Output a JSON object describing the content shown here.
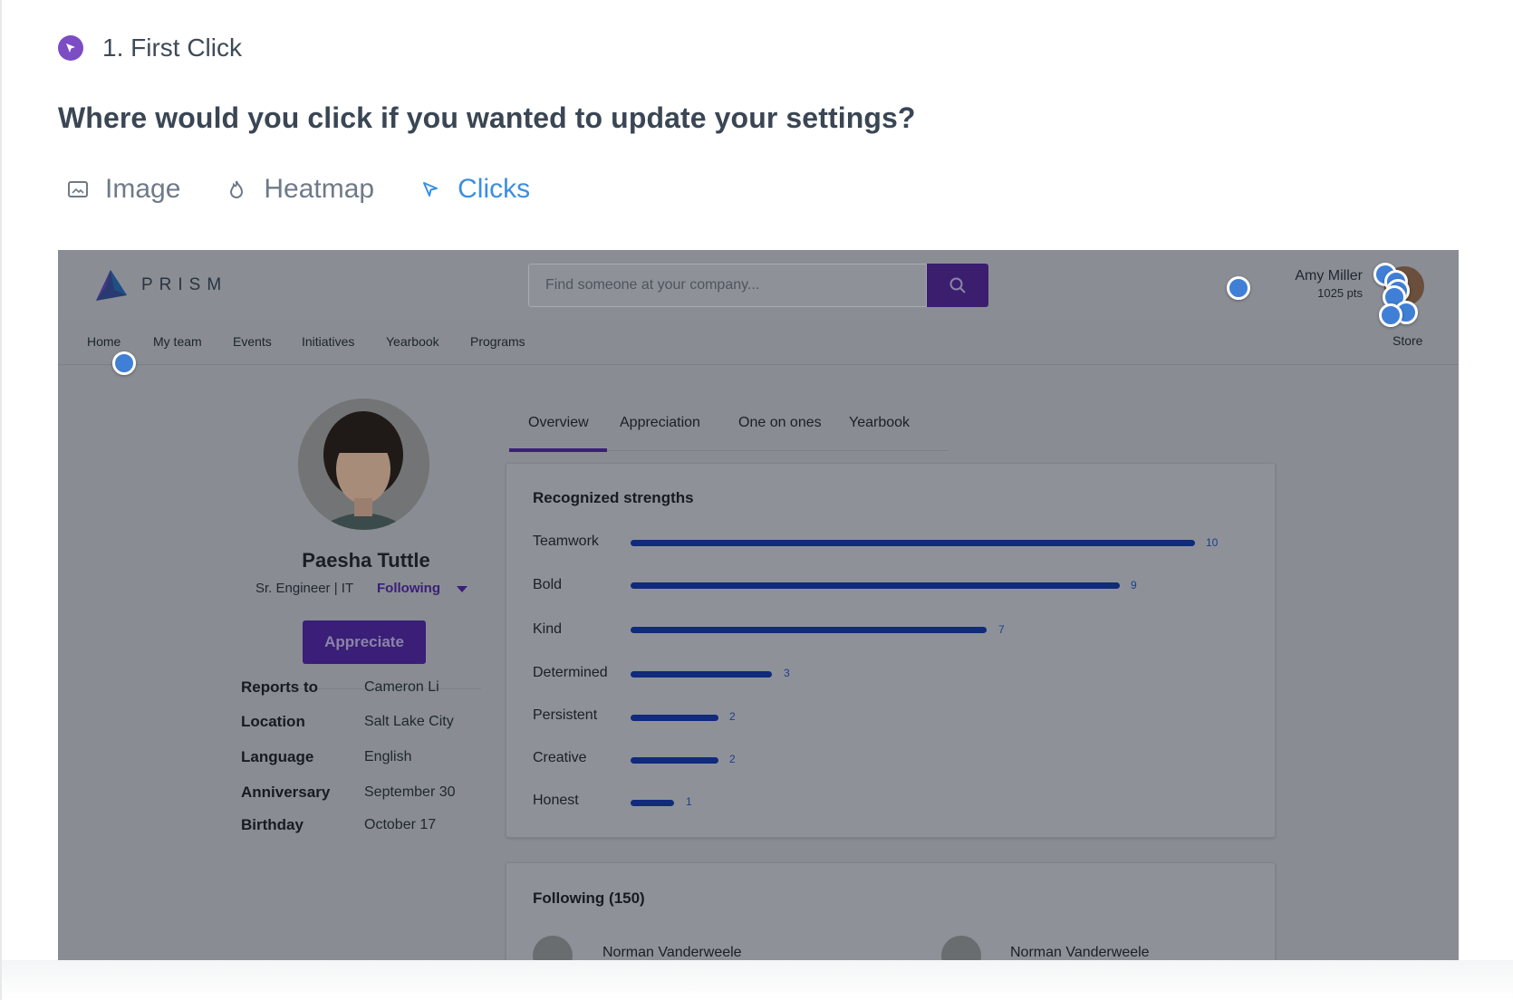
{
  "task": {
    "label": "1. First Click",
    "icon": "cursor-click-icon"
  },
  "question": "Where would you click if you wanted to update your settings?",
  "view_tabs": [
    {
      "label": "Image",
      "icon": "image-icon",
      "active": false
    },
    {
      "label": "Heatmap",
      "icon": "flame-icon",
      "active": false
    },
    {
      "label": "Clicks",
      "icon": "cursor-icon",
      "active": true
    }
  ],
  "colors": {
    "accent": "#3b8fe0",
    "task_icon": "#7b4cc4",
    "click_dot": "#3f7fd6",
    "brand_purple": "#3a1e78",
    "bar_blue": "#102a7c"
  },
  "screenshot": {
    "logo_text": "PRISM",
    "search_placeholder": "Find someone at your company...",
    "user_name": "Amy Miller",
    "user_points": "1025 pts",
    "nav": [
      "Home",
      "My team",
      "Events",
      "Initiatives",
      "Yearbook",
      "Programs"
    ],
    "store_label": "Store",
    "profile": {
      "name": "Paesha Tuttle",
      "title": "Sr. Engineer | IT",
      "follow_label": "Following",
      "appreciate_label": "Appreciate",
      "info": [
        {
          "label": "Reports to",
          "value": "Cameron Li"
        },
        {
          "label": "Location",
          "value": "Salt Lake City"
        },
        {
          "label": "Language",
          "value": "English"
        },
        {
          "label": "Anniversary",
          "value": "September 30"
        },
        {
          "label": "Birthday",
          "value": "October 17"
        }
      ]
    },
    "subtabs": [
      "Overview",
      "Appreciation",
      "One on ones",
      "Yearbook"
    ],
    "strengths_title": "Recognized strengths",
    "strengths": [
      {
        "label": "Teamwork",
        "value": "10"
      },
      {
        "label": "Bold",
        "value": "9"
      },
      {
        "label": "Kind",
        "value": "7"
      },
      {
        "label": "Determined",
        "value": "3"
      },
      {
        "label": "Persistent",
        "value": "2"
      },
      {
        "label": "Creative",
        "value": "2"
      },
      {
        "label": "Honest",
        "value": "1"
      }
    ],
    "following_title": "Following (150)",
    "following": [
      "Norman Vanderweele",
      "Norman Vanderweele"
    ]
  }
}
